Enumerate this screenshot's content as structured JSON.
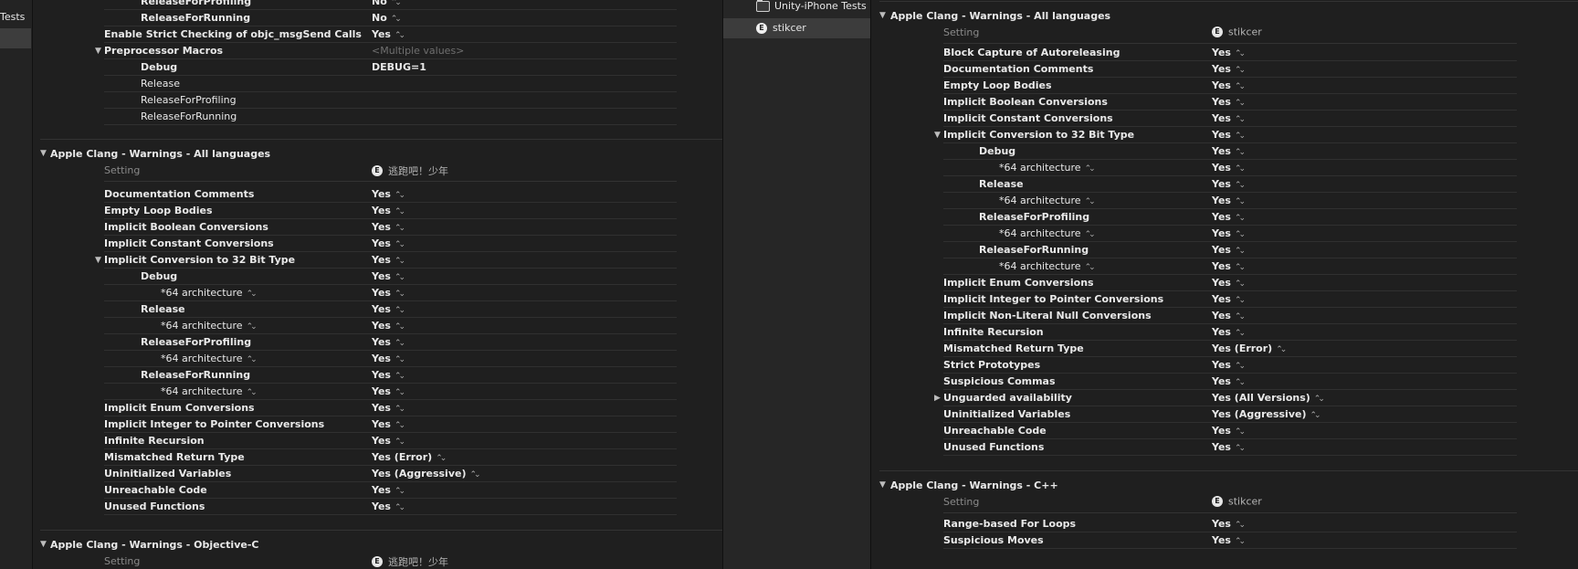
{
  "left_strip": {
    "tests_label": "Tests"
  },
  "left_editor": {
    "top_rows": [
      {
        "name": "ReleaseForProfiling",
        "value": "No",
        "indent": 2,
        "stepper": true
      },
      {
        "name": "ReleaseForRunning",
        "value": "No",
        "indent": 2,
        "stepper": true
      },
      {
        "name": "Enable Strict Checking of objc_msgSend Calls",
        "value": "Yes",
        "indent": 1,
        "stepper": true
      },
      {
        "name": "Preprocessor Macros",
        "value": "<Multiple values>",
        "indent": 1,
        "disclosure": "open",
        "muted": true
      },
      {
        "name": "Debug",
        "value": "DEBUG=1",
        "indent": 2
      },
      {
        "name": "Release",
        "value": "",
        "indent": 2,
        "plain": true
      },
      {
        "name": "ReleaseForProfiling",
        "value": "",
        "indent": 2,
        "plain": true
      },
      {
        "name": "ReleaseForRunning",
        "value": "",
        "indent": 2,
        "plain": true
      }
    ],
    "warnings_section": {
      "title": "Apple Clang - Warnings - All languages",
      "setting_header": "Setting",
      "target_icon_letter": "E",
      "target_name": "逃跑吧！少年",
      "rows": [
        {
          "name": "Documentation Comments",
          "value": "Yes",
          "indent": 1,
          "stepper": true
        },
        {
          "name": "Empty Loop Bodies",
          "value": "Yes",
          "indent": 1,
          "stepper": true
        },
        {
          "name": "Implicit Boolean Conversions",
          "value": "Yes",
          "indent": 1,
          "stepper": true
        },
        {
          "name": "Implicit Constant Conversions",
          "value": "Yes",
          "indent": 1,
          "stepper": true
        },
        {
          "name": "Implicit Conversion to 32 Bit Type",
          "value": "Yes",
          "indent": 1,
          "stepper": true,
          "disclosure": "open"
        },
        {
          "name": "Debug",
          "value": "Yes",
          "indent": 2,
          "stepper": true
        },
        {
          "name": "*64 architecture",
          "value": "Yes",
          "indent": 3,
          "stepper": true,
          "name_stepper": true
        },
        {
          "name": "Release",
          "value": "Yes",
          "indent": 2,
          "stepper": true
        },
        {
          "name": "*64 architecture",
          "value": "Yes",
          "indent": 3,
          "stepper": true,
          "name_stepper": true
        },
        {
          "name": "ReleaseForProfiling",
          "value": "Yes",
          "indent": 2,
          "stepper": true
        },
        {
          "name": "*64 architecture",
          "value": "Yes",
          "indent": 3,
          "stepper": true,
          "name_stepper": true
        },
        {
          "name": "ReleaseForRunning",
          "value": "Yes",
          "indent": 2,
          "stepper": true
        },
        {
          "name": "*64 architecture",
          "value": "Yes",
          "indent": 3,
          "stepper": true,
          "name_stepper": true
        },
        {
          "name": "Implicit Enum Conversions",
          "value": "Yes",
          "indent": 1,
          "stepper": true
        },
        {
          "name": "Implicit Integer to Pointer Conversions",
          "value": "Yes",
          "indent": 1,
          "stepper": true
        },
        {
          "name": "Infinite Recursion",
          "value": "Yes",
          "indent": 1,
          "stepper": true
        },
        {
          "name": "Mismatched Return Type",
          "value": "Yes (Error)",
          "indent": 1,
          "stepper": true
        },
        {
          "name": "Uninitialized Variables",
          "value": "Yes (Aggressive)",
          "indent": 1,
          "stepper": true
        },
        {
          "name": "Unreachable Code",
          "value": "Yes",
          "indent": 1,
          "stepper": true
        },
        {
          "name": "Unused Functions",
          "value": "Yes",
          "indent": 1,
          "stepper": true
        }
      ]
    },
    "objc_section": {
      "title": "Apple Clang - Warnings - Objective-C",
      "setting_header": "Setting",
      "target_icon_letter": "E",
      "target_name": "逃跑吧！少年"
    }
  },
  "right_nav": {
    "items": [
      {
        "label": "Unity-iPhone Tests",
        "icon": "folder-icon",
        "selected": false
      },
      {
        "label": "stikcer",
        "icon": "target-icon",
        "icon_letter": "E",
        "selected": true
      }
    ]
  },
  "right_editor": {
    "warnings_section": {
      "title": "Apple Clang - Warnings - All languages",
      "setting_header": "Setting",
      "target_icon_letter": "E",
      "target_name": "stikcer",
      "rows": [
        {
          "name": "Block Capture of Autoreleasing",
          "value": "Yes",
          "indent": 1,
          "stepper": true
        },
        {
          "name": "Documentation Comments",
          "value": "Yes",
          "indent": 1,
          "stepper": true
        },
        {
          "name": "Empty Loop Bodies",
          "value": "Yes",
          "indent": 1,
          "stepper": true
        },
        {
          "name": "Implicit Boolean Conversions",
          "value": "Yes",
          "indent": 1,
          "stepper": true
        },
        {
          "name": "Implicit Constant Conversions",
          "value": "Yes",
          "indent": 1,
          "stepper": true
        },
        {
          "name": "Implicit Conversion to 32 Bit Type",
          "value": "Yes",
          "indent": 1,
          "stepper": true,
          "disclosure": "open"
        },
        {
          "name": "Debug",
          "value": "Yes",
          "indent": 2,
          "stepper": true
        },
        {
          "name": "*64 architecture",
          "value": "Yes",
          "indent": 3,
          "stepper": true,
          "name_stepper": true
        },
        {
          "name": "Release",
          "value": "Yes",
          "indent": 2,
          "stepper": true
        },
        {
          "name": "*64 architecture",
          "value": "Yes",
          "indent": 3,
          "stepper": true,
          "name_stepper": true
        },
        {
          "name": "ReleaseForProfiling",
          "value": "Yes",
          "indent": 2,
          "stepper": true
        },
        {
          "name": "*64 architecture",
          "value": "Yes",
          "indent": 3,
          "stepper": true,
          "name_stepper": true
        },
        {
          "name": "ReleaseForRunning",
          "value": "Yes",
          "indent": 2,
          "stepper": true
        },
        {
          "name": "*64 architecture",
          "value": "Yes",
          "indent": 3,
          "stepper": true,
          "name_stepper": true
        },
        {
          "name": "Implicit Enum Conversions",
          "value": "Yes",
          "indent": 1,
          "stepper": true
        },
        {
          "name": "Implicit Integer to Pointer Conversions",
          "value": "Yes",
          "indent": 1,
          "stepper": true
        },
        {
          "name": "Implicit Non-Literal Null Conversions",
          "value": "Yes",
          "indent": 1,
          "stepper": true
        },
        {
          "name": "Infinite Recursion",
          "value": "Yes",
          "indent": 1,
          "stepper": true
        },
        {
          "name": "Mismatched Return Type",
          "value": "Yes (Error)",
          "indent": 1,
          "stepper": true
        },
        {
          "name": "Strict Prototypes",
          "value": "Yes",
          "indent": 1,
          "stepper": true
        },
        {
          "name": "Suspicious Commas",
          "value": "Yes",
          "indent": 1,
          "stepper": true
        },
        {
          "name": "Unguarded availability",
          "value": "Yes (All Versions)",
          "indent": 1,
          "stepper": true,
          "disclosure": "closed"
        },
        {
          "name": "Uninitialized Variables",
          "value": "Yes (Aggressive)",
          "indent": 1,
          "stepper": true
        },
        {
          "name": "Unreachable Code",
          "value": "Yes",
          "indent": 1,
          "stepper": true
        },
        {
          "name": "Unused Functions",
          "value": "Yes",
          "indent": 1,
          "stepper": true
        }
      ]
    },
    "cpp_section": {
      "title": "Apple Clang - Warnings - C++",
      "setting_header": "Setting",
      "target_icon_letter": "E",
      "target_name": "stikcer",
      "rows": [
        {
          "name": "Range-based For Loops",
          "value": "Yes",
          "indent": 1,
          "stepper": true
        },
        {
          "name": "Suspicious Moves",
          "value": "Yes",
          "indent": 1,
          "stepper": true
        }
      ]
    }
  }
}
